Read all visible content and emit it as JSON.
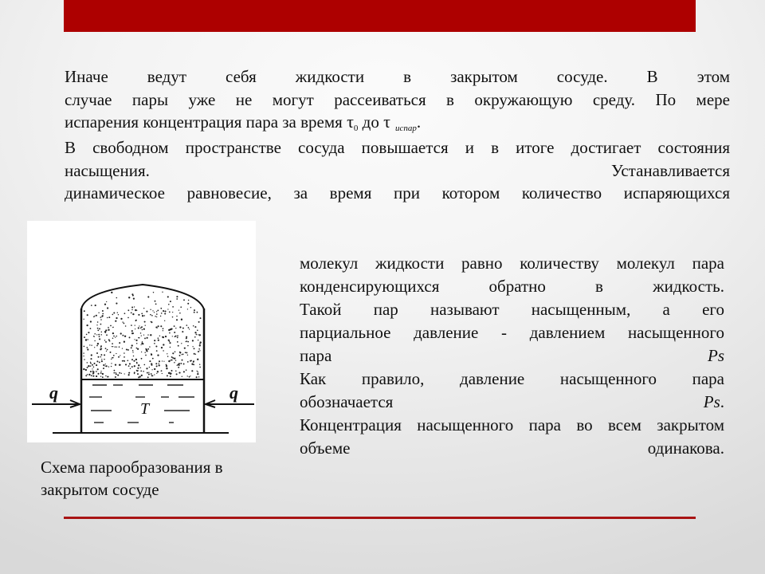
{
  "slide": {
    "accent_color": "#ad0000",
    "paragraph_1": {
      "lines": [
        "Иначе ведут себя жидкости в закрытом сосуде. В этом",
        "случае пары уже не могут рассеиваться в окружающую среду. По мере"
      ],
      "line_3_prefix": "испарения концентрация пара за время ",
      "tau_symbol": "τ",
      "sub_0": "0",
      "mid_word": " до ",
      "sub_evap": "испар",
      "line_3_suffix": "."
    },
    "paragraph_2": {
      "lines": [
        "В свободном пространстве сосуда повышается и в итоге достигает состояния",
        "насыщения. Устанавливается",
        "динамическое равновесие, за время при котором количество испаряющихся"
      ]
    },
    "right_column": {
      "lines": [
        "молекул жидкости равно количеству молекул пара",
        "конденсирующихся обратно в жидкость.",
        "Такой пар называют насыщенным, а его",
        "парциальное давление - давлением насыщенного"
      ],
      "line_5_prefix": "пара ",
      "ps_symbol": "Ps",
      "line_6": "Как правило, давление насыщенного пара",
      "line_7_prefix": "обозначается ",
      "line_7_suffix": ".",
      "line_8": "Концентрация насыщенного пара во всем закрытом",
      "line_9": "объеме одинакова."
    },
    "figure": {
      "heat_flux_label": "q",
      "temperature_label": "T"
    },
    "caption": {
      "lines": [
        "Схема парообразования в",
        "закрытом сосуде"
      ]
    }
  }
}
